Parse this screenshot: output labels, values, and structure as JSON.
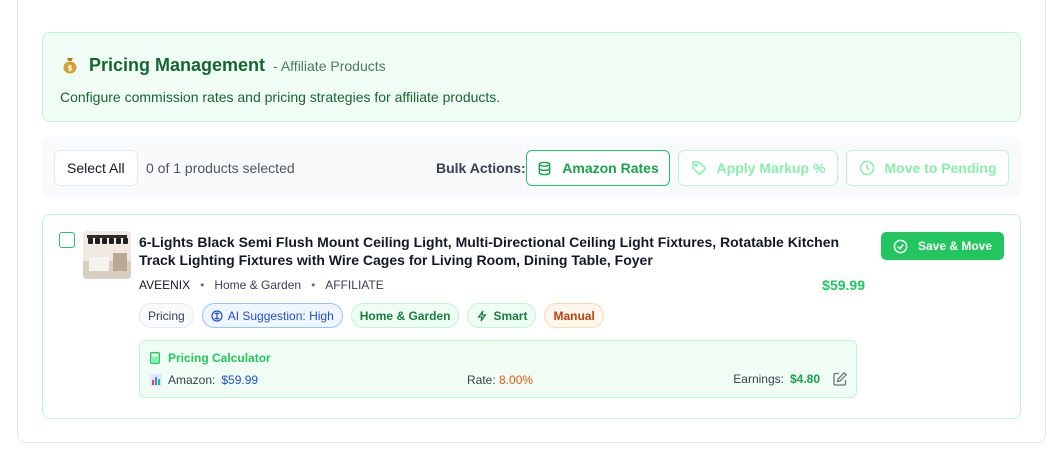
{
  "header": {
    "title": "Pricing Management",
    "subtitle": "- Affiliate Products",
    "description": "Configure commission rates and pricing strategies for affiliate products."
  },
  "toolbar": {
    "select_all": "Select All",
    "selection_count": "0 of 1 products selected",
    "bulk_label": "Bulk Actions:",
    "amazon_rates": "Amazon Rates",
    "apply_markup": "Apply Markup %",
    "move_pending": "Move to Pending"
  },
  "product": {
    "title": "6-Lights Black Semi Flush Mount Ceiling Light, Multi-Directional Ceiling Light Fixtures, Rotatable Kitchen Track Lighting Fixtures with Wire Cages for Living Room, Dining Table, Foyer",
    "brand": "AVEENIX",
    "category": "Home & Garden",
    "type": "AFFILIATE",
    "price": "$59.99",
    "save_label": "Save & Move",
    "tags": {
      "pricing": "Pricing",
      "ai": "AI Suggestion: High",
      "category": "Home & Garden",
      "smart": "Smart",
      "manual": "Manual"
    },
    "calculator": {
      "title": "Pricing Calculator",
      "amazon_label": "Amazon:",
      "amazon_value": "$59.99",
      "rate_label": "Rate:",
      "rate_value": "8.00%",
      "earnings_label": "Earnings:",
      "earnings_value": "$4.80"
    }
  },
  "colors": {
    "accent": "#22c55e",
    "accent_dark": "#166534",
    "banner_bg": "#f0fdf4"
  }
}
